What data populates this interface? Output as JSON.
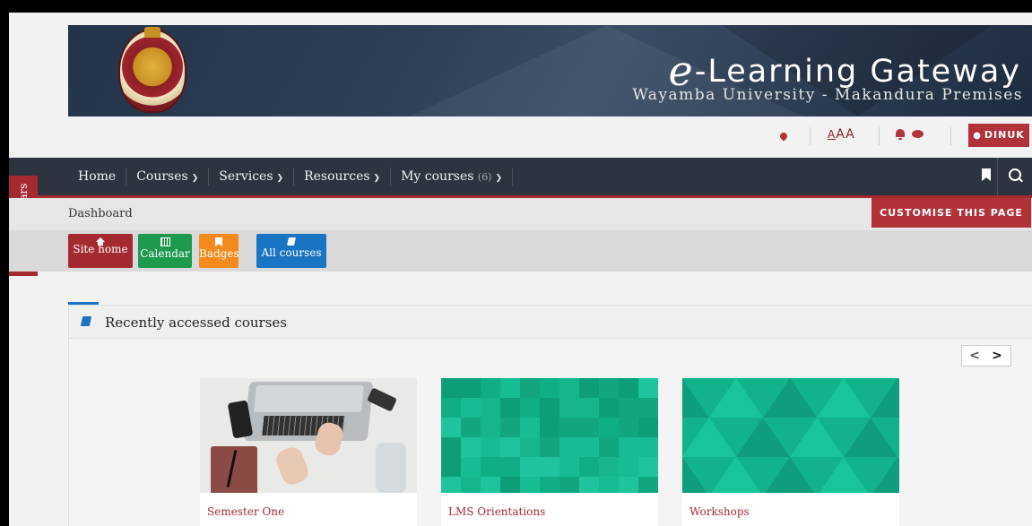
{
  "banner": {
    "title_e": "e",
    "title_rest": "-Learning Gateway",
    "subtitle": "Wayamba University - Makandura Premises"
  },
  "userbar": {
    "font_size_label_small": "A",
    "font_size_label_rest": "AA",
    "user_name": "DINUK"
  },
  "nav": {
    "items": [
      {
        "label": "Home",
        "caret": ""
      },
      {
        "label": "Courses",
        "caret": "v"
      },
      {
        "label": "Services",
        "caret": "v"
      },
      {
        "label": "Resources",
        "caret": "v"
      },
      {
        "label": "My courses",
        "count": "(6)",
        "caret": "v"
      }
    ]
  },
  "breadcrumb": "Dashboard",
  "customise_label": "CUSTOMISE THIS PAGE",
  "sidebar_toggle": "Show sidebars",
  "quick_links": [
    {
      "label": "Site home",
      "icon": "home-icon",
      "color": "#a52a30"
    },
    {
      "label": "Calendar",
      "icon": "calendar-icon",
      "color": "#1e9a4f"
    },
    {
      "label": "Badges",
      "icon": "bookmark-icon",
      "color": "#f38a1b"
    },
    {
      "label": "All courses",
      "icon": "book-icon",
      "color": "#1a74c4"
    }
  ],
  "block": {
    "title": "Recently accessed courses",
    "pager_prev": "<",
    "pager_next": ">",
    "courses": [
      {
        "name": "Semester One"
      },
      {
        "name": "LMS Orientations"
      },
      {
        "name": "Workshops"
      }
    ]
  },
  "colors": {
    "accent_red": "#a52a30",
    "nav_bg": "#2d3440",
    "teal": "#14b48a"
  }
}
